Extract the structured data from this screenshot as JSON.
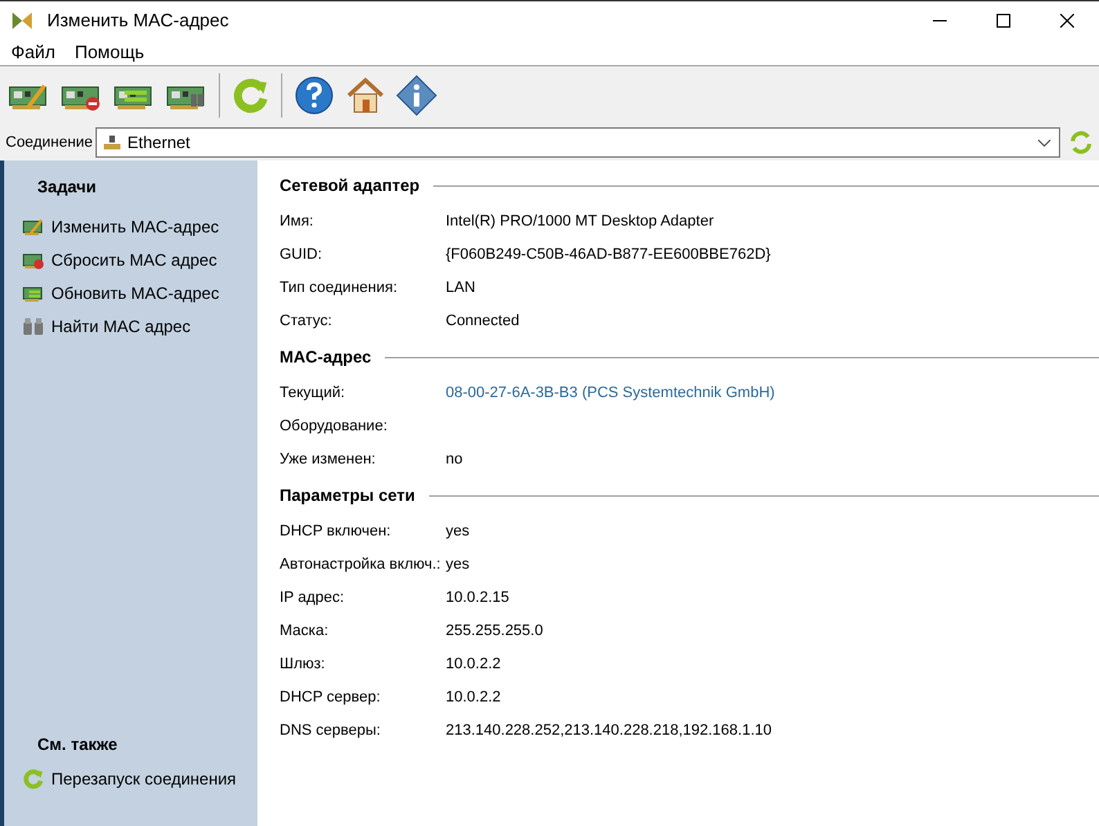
{
  "window": {
    "title": "Изменить MAC-адрес"
  },
  "menu": [
    "Файл",
    "Помощь"
  ],
  "connection": {
    "label": "Соединение",
    "value": "Ethernet"
  },
  "sidebar": {
    "tasks_title": "Задачи",
    "tasks": [
      {
        "label": "Изменить MAC-адрес"
      },
      {
        "label": "Сбросить MAC адрес"
      },
      {
        "label": "Обновить MAC-адрес"
      },
      {
        "label": "Найти MAC адрес"
      }
    ],
    "see_also_title": "См. также",
    "see_also": [
      {
        "label": "Перезапуск соединения"
      }
    ]
  },
  "sections": [
    {
      "title": "Сетевой адаптер",
      "rows": [
        {
          "label": "Имя:",
          "value": "Intel(R) PRO/1000 MT Desktop Adapter"
        },
        {
          "label": "GUID:",
          "value": "{F060B249-C50B-46AD-B877-EE600BBE762D}"
        },
        {
          "label": "Тип соединения:",
          "value": "LAN"
        },
        {
          "label": "Статус:",
          "value": "Connected"
        }
      ]
    },
    {
      "title": "MAC-адрес",
      "rows": [
        {
          "label": "Текущий:",
          "value": "08-00-27-6A-3B-B3 (PCS Systemtechnik GmbH)",
          "link": true
        },
        {
          "label": "Оборудование:"
        },
        {
          "label": "Уже изменен:",
          "value": "no"
        }
      ]
    },
    {
      "title": "Параметры сети",
      "rows": [
        {
          "label": "DHCP включен:",
          "value": "yes"
        },
        {
          "label": "Автонастройка включ.:",
          "value": "yes"
        },
        {
          "label": "IP адрес:",
          "value": "10.0.2.15"
        },
        {
          "label": "Маска:",
          "value": "255.255.255.0"
        },
        {
          "label": "Шлюз:",
          "value": "10.0.2.2"
        },
        {
          "label": "DHCP сервер:",
          "value": "10.0.2.2"
        },
        {
          "label": "DNS серверы:",
          "value": "213.140.228.252,213.140.228.218,192.168.1.10"
        }
      ]
    }
  ]
}
